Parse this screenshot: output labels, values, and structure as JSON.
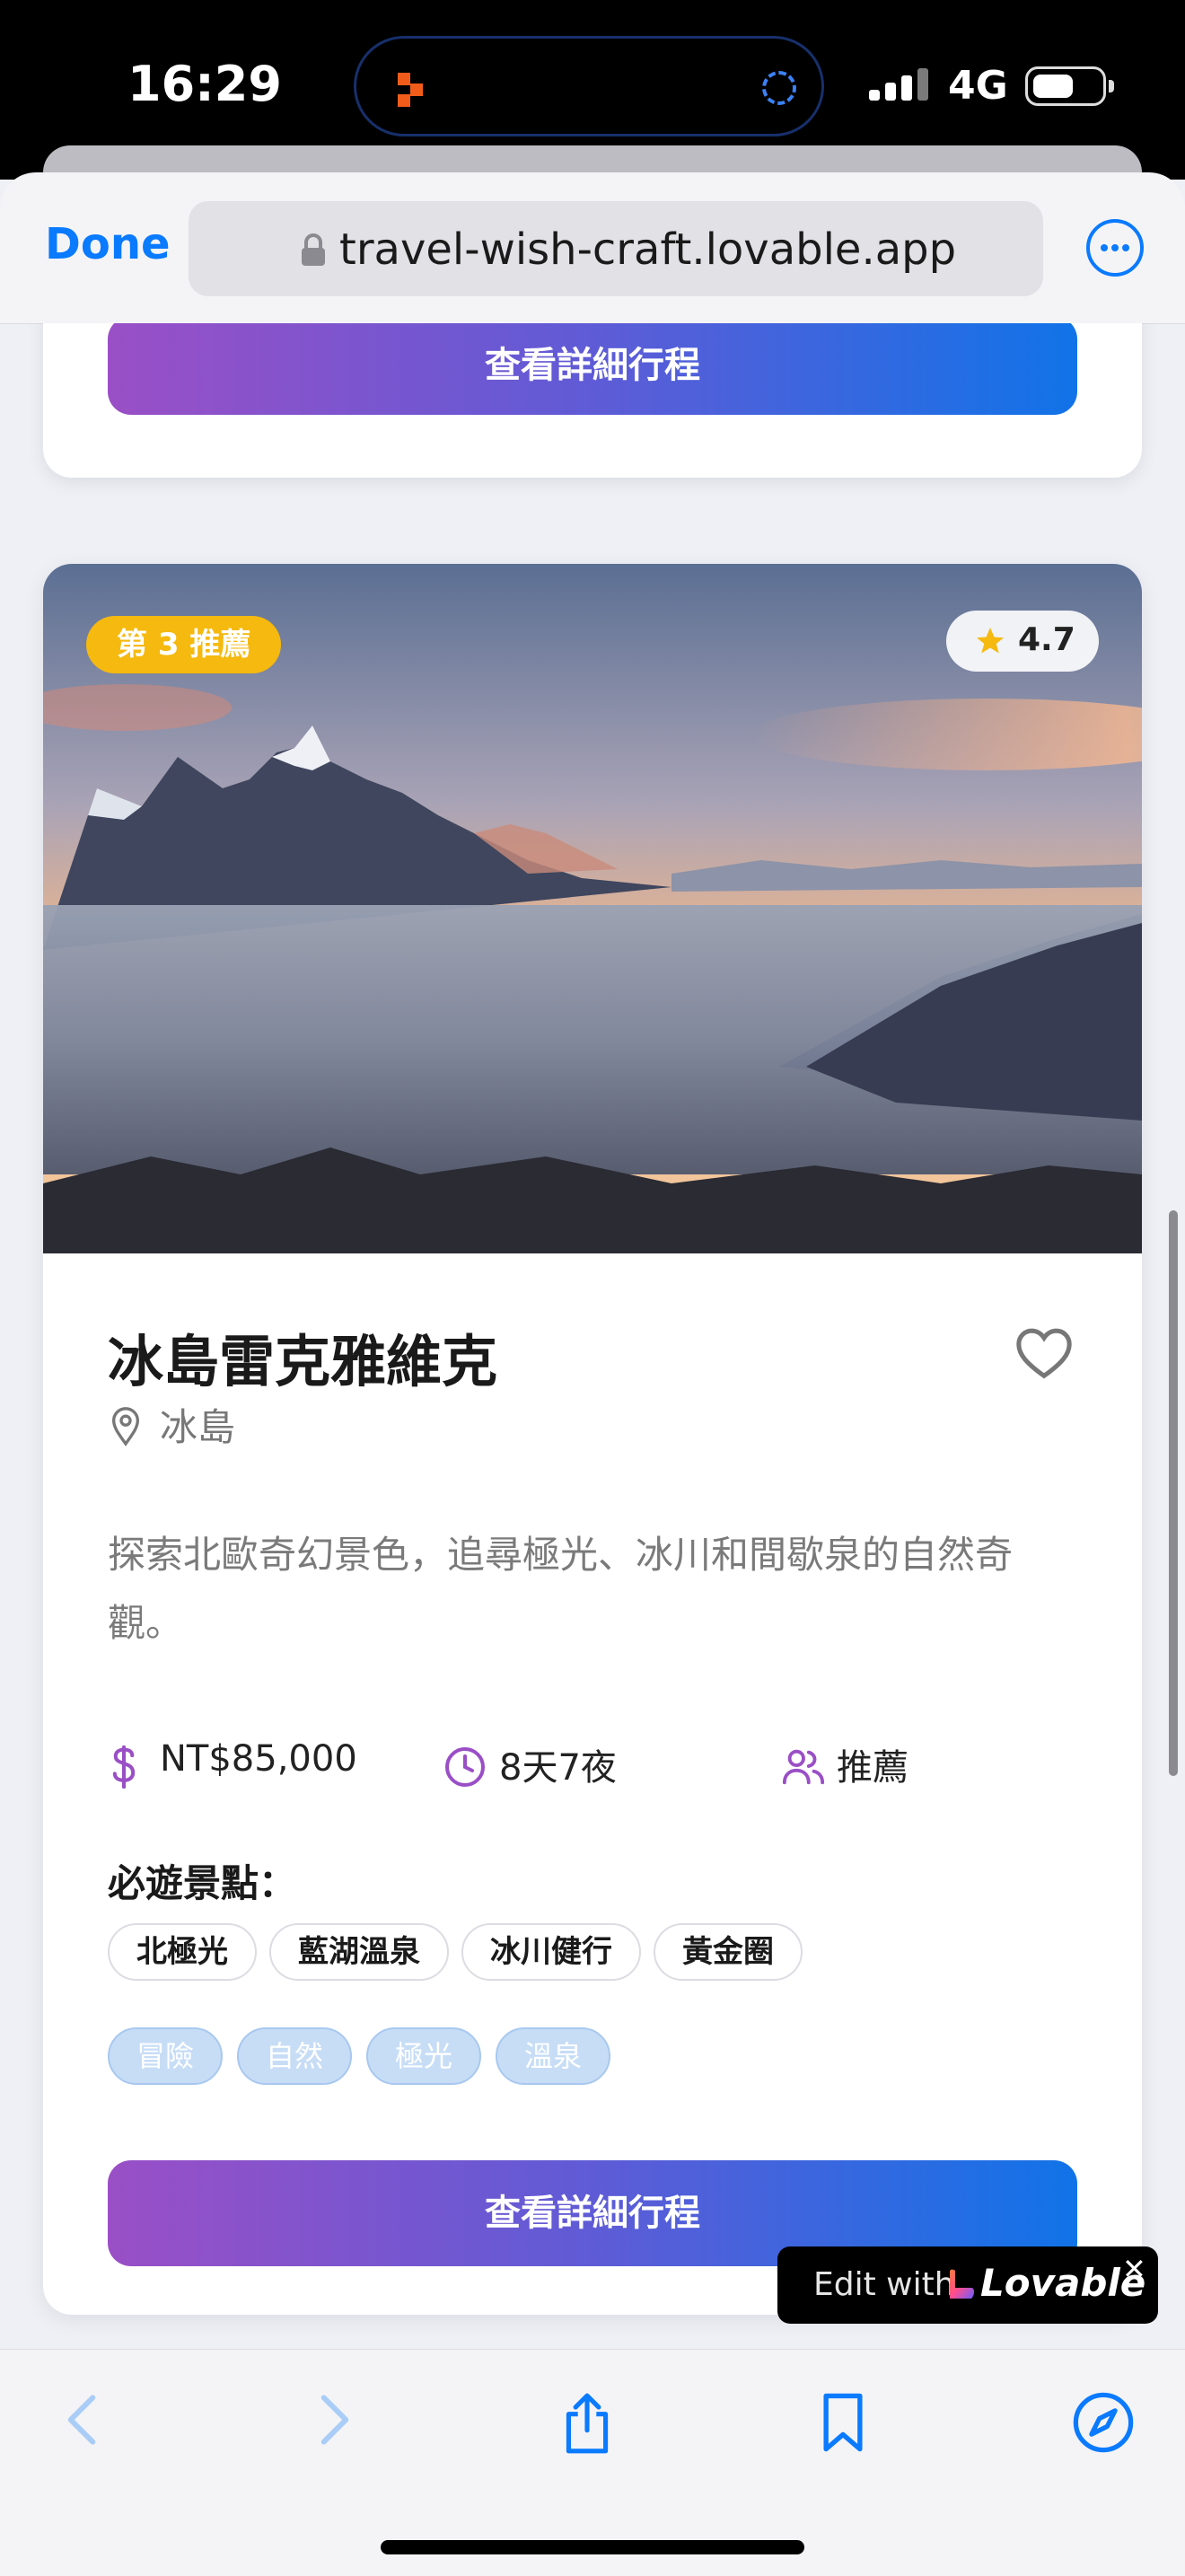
{
  "status_bar": {
    "time": "16:29",
    "network": "4G"
  },
  "browser": {
    "done_label": "Done",
    "url": "travel-wish-craft.lovable.app"
  },
  "prev_card": {
    "button_label": "查看詳細行程"
  },
  "card": {
    "rank_badge": "第 3 推薦",
    "rating": "4.7",
    "title": "冰島雷克雅維克",
    "location": "冰島",
    "description": "探索北歐奇幻景色，追尋極光、冰川和間歇泉的自然奇觀。",
    "price": "NT$85,000",
    "duration": "8天7夜",
    "audience": "推薦",
    "must_see_label": "必遊景點：",
    "must_see": [
      "北極光",
      "藍湖溫泉",
      "冰川健行",
      "黃金圈"
    ],
    "tags": [
      "冒險",
      "自然",
      "極光",
      "溫泉"
    ],
    "button_label": "查看詳細行程"
  },
  "lovable_badge": {
    "prefix": "Edit with",
    "brand": "Lovable",
    "close": "✕"
  },
  "colors": {
    "accent_blue": "#0a7aff",
    "gradient_start": "#9a4fc6",
    "gradient_end": "#1173e8",
    "rank_badge": "#f5b90f",
    "info_icon_purple": "#9a4fc6"
  }
}
